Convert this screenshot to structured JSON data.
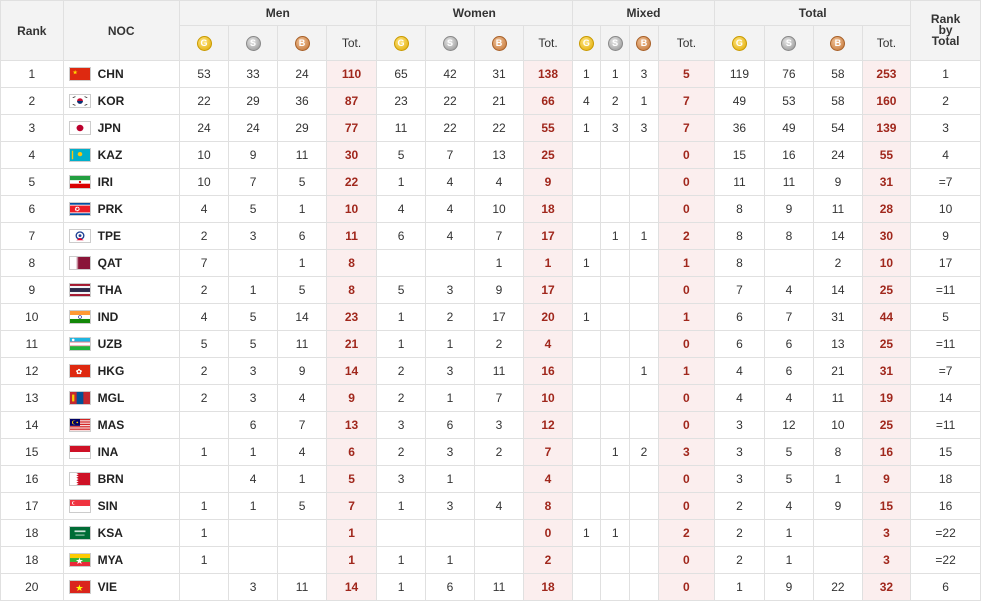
{
  "headers": {
    "rank": "Rank",
    "noc": "NOC",
    "men": "Men",
    "women": "Women",
    "mixed": "Mixed",
    "total": "Total",
    "rank_by_total": [
      "Rank",
      "by",
      "Total"
    ],
    "tot": "Tot.",
    "medal_icons": {
      "gold": "gold-medal-icon",
      "silver": "silver-medal-icon",
      "bronze": "bronze-medal-icon"
    }
  },
  "colors": {
    "total_bg": "#fbeeee",
    "total_text": "#a0271c",
    "header_bg": "#f3f3f3"
  },
  "rows": [
    {
      "rank": "1",
      "noc": "CHN",
      "flag": "china-flag-icon",
      "men": [
        "53",
        "33",
        "24",
        "110"
      ],
      "women": [
        "65",
        "42",
        "31",
        "138"
      ],
      "mixed": [
        "1",
        "1",
        "3",
        "5"
      ],
      "total": [
        "119",
        "76",
        "58",
        "253"
      ],
      "rbt": "1"
    },
    {
      "rank": "2",
      "noc": "KOR",
      "flag": "south-korea-flag-icon",
      "men": [
        "22",
        "29",
        "36",
        "87"
      ],
      "women": [
        "23",
        "22",
        "21",
        "66"
      ],
      "mixed": [
        "4",
        "2",
        "1",
        "7"
      ],
      "total": [
        "49",
        "53",
        "58",
        "160"
      ],
      "rbt": "2"
    },
    {
      "rank": "3",
      "noc": "JPN",
      "flag": "japan-flag-icon",
      "men": [
        "24",
        "24",
        "29",
        "77"
      ],
      "women": [
        "11",
        "22",
        "22",
        "55"
      ],
      "mixed": [
        "1",
        "3",
        "3",
        "7"
      ],
      "total": [
        "36",
        "49",
        "54",
        "139"
      ],
      "rbt": "3"
    },
    {
      "rank": "4",
      "noc": "KAZ",
      "flag": "kazakhstan-flag-icon",
      "men": [
        "10",
        "9",
        "11",
        "30"
      ],
      "women": [
        "5",
        "7",
        "13",
        "25"
      ],
      "mixed": [
        "",
        "",
        "",
        "0"
      ],
      "total": [
        "15",
        "16",
        "24",
        "55"
      ],
      "rbt": "4"
    },
    {
      "rank": "5",
      "noc": "IRI",
      "flag": "iran-flag-icon",
      "men": [
        "10",
        "7",
        "5",
        "22"
      ],
      "women": [
        "1",
        "4",
        "4",
        "9"
      ],
      "mixed": [
        "",
        "",
        "",
        "0"
      ],
      "total": [
        "11",
        "11",
        "9",
        "31"
      ],
      "rbt": "=7"
    },
    {
      "rank": "6",
      "noc": "PRK",
      "flag": "north-korea-flag-icon",
      "men": [
        "4",
        "5",
        "1",
        "10"
      ],
      "women": [
        "4",
        "4",
        "10",
        "18"
      ],
      "mixed": [
        "",
        "",
        "",
        "0"
      ],
      "total": [
        "8",
        "9",
        "11",
        "28"
      ],
      "rbt": "10"
    },
    {
      "rank": "7",
      "noc": "TPE",
      "flag": "chinese-taipei-flag-icon",
      "men": [
        "2",
        "3",
        "6",
        "11"
      ],
      "women": [
        "6",
        "4",
        "7",
        "17"
      ],
      "mixed": [
        "",
        "1",
        "1",
        "2"
      ],
      "total": [
        "8",
        "8",
        "14",
        "30"
      ],
      "rbt": "9"
    },
    {
      "rank": "8",
      "noc": "QAT",
      "flag": "qatar-flag-icon",
      "men": [
        "7",
        "",
        "1",
        "8"
      ],
      "women": [
        "",
        "",
        "1",
        "1"
      ],
      "mixed": [
        "1",
        "",
        "",
        "1"
      ],
      "total": [
        "8",
        "",
        "2",
        "10"
      ],
      "rbt": "17"
    },
    {
      "rank": "9",
      "noc": "THA",
      "flag": "thailand-flag-icon",
      "men": [
        "2",
        "1",
        "5",
        "8"
      ],
      "women": [
        "5",
        "3",
        "9",
        "17"
      ],
      "mixed": [
        "",
        "",
        "",
        "0"
      ],
      "total": [
        "7",
        "4",
        "14",
        "25"
      ],
      "rbt": "=11"
    },
    {
      "rank": "10",
      "noc": "IND",
      "flag": "india-flag-icon",
      "men": [
        "4",
        "5",
        "14",
        "23"
      ],
      "women": [
        "1",
        "2",
        "17",
        "20"
      ],
      "mixed": [
        "1",
        "",
        "",
        "1"
      ],
      "total": [
        "6",
        "7",
        "31",
        "44"
      ],
      "rbt": "5"
    },
    {
      "rank": "11",
      "noc": "UZB",
      "flag": "uzbekistan-flag-icon",
      "men": [
        "5",
        "5",
        "11",
        "21"
      ],
      "women": [
        "1",
        "1",
        "2",
        "4"
      ],
      "mixed": [
        "",
        "",
        "",
        "0"
      ],
      "total": [
        "6",
        "6",
        "13",
        "25"
      ],
      "rbt": "=11"
    },
    {
      "rank": "12",
      "noc": "HKG",
      "flag": "hong-kong-flag-icon",
      "men": [
        "2",
        "3",
        "9",
        "14"
      ],
      "women": [
        "2",
        "3",
        "11",
        "16"
      ],
      "mixed": [
        "",
        "",
        "1",
        "1"
      ],
      "total": [
        "4",
        "6",
        "21",
        "31"
      ],
      "rbt": "=7"
    },
    {
      "rank": "13",
      "noc": "MGL",
      "flag": "mongolia-flag-icon",
      "men": [
        "2",
        "3",
        "4",
        "9"
      ],
      "women": [
        "2",
        "1",
        "7",
        "10"
      ],
      "mixed": [
        "",
        "",
        "",
        "0"
      ],
      "total": [
        "4",
        "4",
        "11",
        "19"
      ],
      "rbt": "14"
    },
    {
      "rank": "14",
      "noc": "MAS",
      "flag": "malaysia-flag-icon",
      "men": [
        "",
        "6",
        "7",
        "13"
      ],
      "women": [
        "3",
        "6",
        "3",
        "12"
      ],
      "mixed": [
        "",
        "",
        "",
        "0"
      ],
      "total": [
        "3",
        "12",
        "10",
        "25"
      ],
      "rbt": "=11"
    },
    {
      "rank": "15",
      "noc": "INA",
      "flag": "indonesia-flag-icon",
      "men": [
        "1",
        "1",
        "4",
        "6"
      ],
      "women": [
        "2",
        "3",
        "2",
        "7"
      ],
      "mixed": [
        "",
        "1",
        "2",
        "3"
      ],
      "total": [
        "3",
        "5",
        "8",
        "16"
      ],
      "rbt": "15"
    },
    {
      "rank": "16",
      "noc": "BRN",
      "flag": "bahrain-flag-icon",
      "men": [
        "",
        "4",
        "1",
        "5"
      ],
      "women": [
        "3",
        "1",
        "",
        "4"
      ],
      "mixed": [
        "",
        "",
        "",
        "0"
      ],
      "total": [
        "3",
        "5",
        "1",
        "9"
      ],
      "rbt": "18"
    },
    {
      "rank": "17",
      "noc": "SIN",
      "flag": "singapore-flag-icon",
      "men": [
        "1",
        "1",
        "5",
        "7"
      ],
      "women": [
        "1",
        "3",
        "4",
        "8"
      ],
      "mixed": [
        "",
        "",
        "",
        "0"
      ],
      "total": [
        "2",
        "4",
        "9",
        "15"
      ],
      "rbt": "16"
    },
    {
      "rank": "18",
      "noc": "KSA",
      "flag": "saudi-arabia-flag-icon",
      "men": [
        "1",
        "",
        "",
        "1"
      ],
      "women": [
        "",
        "",
        "",
        "0"
      ],
      "mixed": [
        "1",
        "1",
        "",
        "2"
      ],
      "total": [
        "2",
        "1",
        "",
        "3"
      ],
      "rbt": "=22"
    },
    {
      "rank": "18",
      "noc": "MYA",
      "flag": "myanmar-flag-icon",
      "men": [
        "1",
        "",
        "",
        "1"
      ],
      "women": [
        "1",
        "1",
        "",
        "2"
      ],
      "mixed": [
        "",
        "",
        "",
        "0"
      ],
      "total": [
        "2",
        "1",
        "",
        "3"
      ],
      "rbt": "=22"
    },
    {
      "rank": "20",
      "noc": "VIE",
      "flag": "vietnam-flag-icon",
      "men": [
        "",
        "3",
        "11",
        "14"
      ],
      "women": [
        "1",
        "6",
        "11",
        "18"
      ],
      "mixed": [
        "",
        "",
        "",
        "0"
      ],
      "total": [
        "1",
        "9",
        "22",
        "32"
      ],
      "rbt": "6"
    }
  ]
}
